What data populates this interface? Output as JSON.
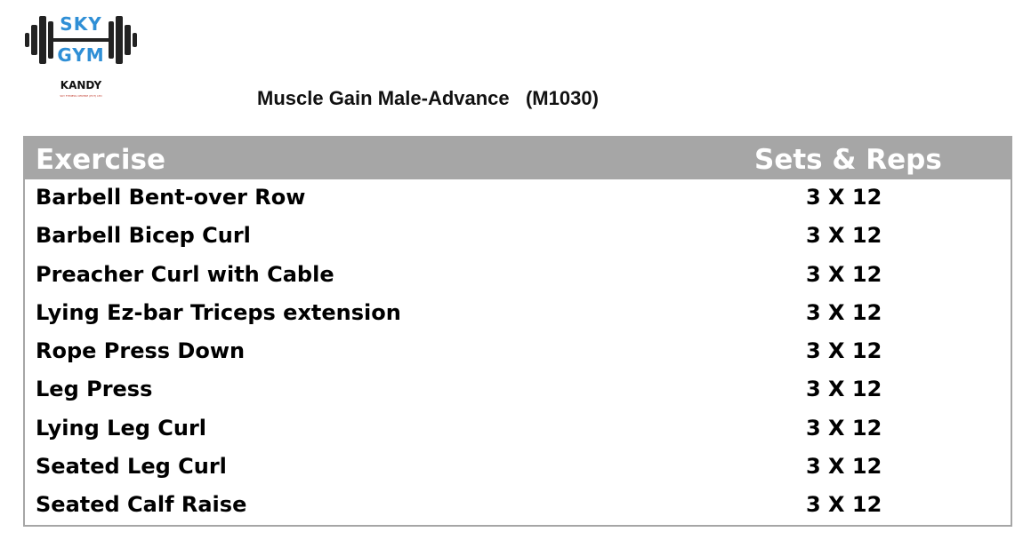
{
  "logo": {
    "word_top": "SKY",
    "word_bottom": "GYM",
    "city": "KANDY",
    "tagline": "SKY FITNESS CENTRE (PVT) LTD",
    "brand_color": "#2f8fd6",
    "icon": "barbell-icon"
  },
  "title": "Muscle Gain Male-Advance   (M1030)",
  "table": {
    "header_color": "#a6a6a6",
    "headers": {
      "exercise": "Exercise",
      "sets_reps": "Sets & Reps"
    },
    "rows": [
      {
        "exercise": "Barbell Bent-over Row",
        "sets_reps": "3 X 12"
      },
      {
        "exercise": "Barbell Bicep Curl",
        "sets_reps": "3 X 12"
      },
      {
        "exercise": "Preacher Curl with Cable",
        "sets_reps": "3 X 12"
      },
      {
        "exercise": "Lying Ez-bar Triceps extension",
        "sets_reps": "3 X 12"
      },
      {
        "exercise": "Rope Press Down",
        "sets_reps": "3 X 12"
      },
      {
        "exercise": "Leg Press",
        "sets_reps": "3 X 12"
      },
      {
        "exercise": "Lying Leg Curl",
        "sets_reps": "3 X 12"
      },
      {
        "exercise": "Seated Leg Curl",
        "sets_reps": "3 X 12"
      },
      {
        "exercise": "Seated Calf Raise",
        "sets_reps": "3 X 12"
      }
    ]
  }
}
